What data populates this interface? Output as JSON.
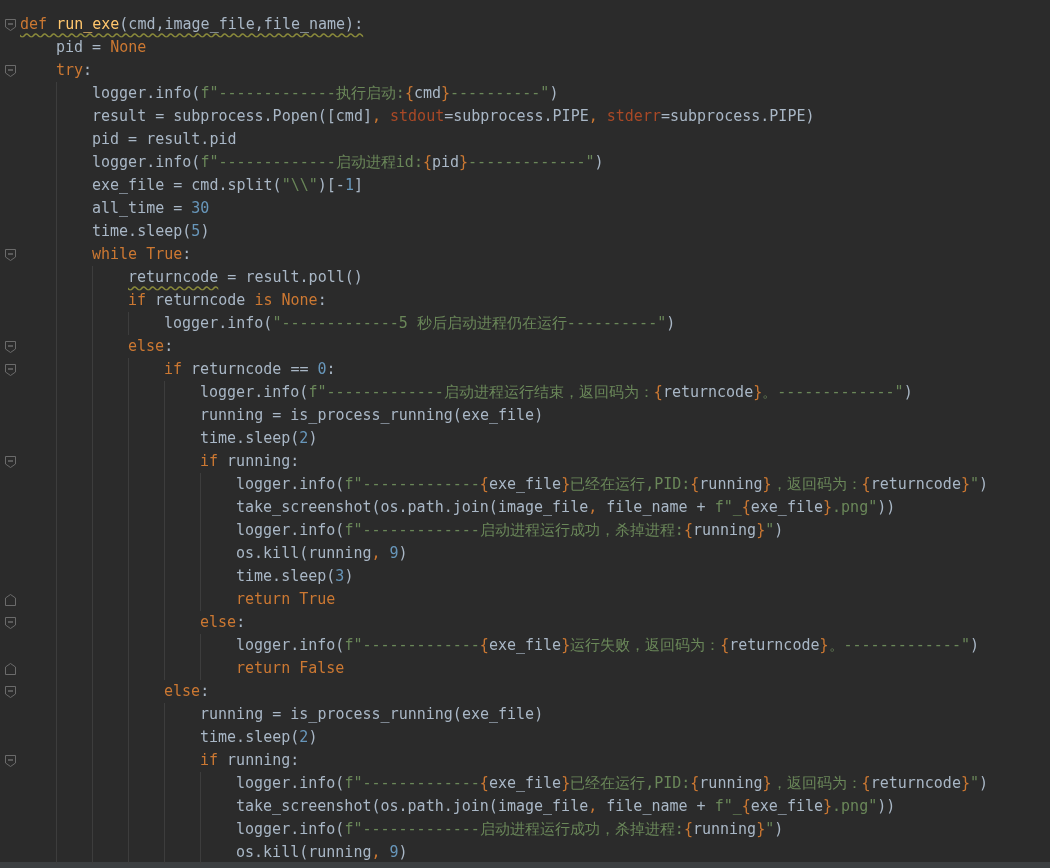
{
  "lines": [
    {
      "fold_start": true,
      "tokens": [
        {
          "kind": "kw",
          "text": "def ",
          "warning": true
        },
        {
          "kind": "fn",
          "text": "run_exe",
          "warning": true
        },
        {
          "kind": "plain",
          "text": "(cmd,image_file,file_name):",
          "warning": true
        }
      ],
      "children": [
        {
          "tokens": [
            {
              "kind": "plain",
              "text": "pid = "
            },
            {
              "kind": "kw",
              "text": "None"
            }
          ]
        },
        {
          "fold_start": true,
          "tokens": [
            {
              "kind": "kw",
              "text": "try"
            },
            {
              "kind": "plain",
              "text": ":"
            }
          ],
          "children": [
            {
              "tokens": [
                {
                  "kind": "plain",
                  "text": "logger.info("
                },
                {
                  "kind": "str",
                  "text": "f\"-------------执行启动:"
                },
                {
                  "kind": "brace",
                  "text": "{"
                },
                {
                  "kind": "plain",
                  "text": "cmd"
                },
                {
                  "kind": "brace",
                  "text": "}"
                },
                {
                  "kind": "str",
                  "text": "----------\""
                },
                {
                  "kind": "plain",
                  "text": ")"
                }
              ]
            },
            {
              "tokens": [
                {
                  "kind": "plain",
                  "text": "result = subprocess.Popen([cmd]"
                },
                {
                  "kind": "kw",
                  "text": ", "
                },
                {
                  "kind": "kwarg",
                  "text": "stdout"
                },
                {
                  "kind": "plain",
                  "text": "=subprocess.PIPE"
                },
                {
                  "kind": "kw",
                  "text": ", "
                },
                {
                  "kind": "kwarg",
                  "text": "stderr"
                },
                {
                  "kind": "plain",
                  "text": "=subprocess.PIPE)"
                }
              ]
            },
            {
              "tokens": [
                {
                  "kind": "plain",
                  "text": "pid = result.pid"
                }
              ]
            },
            {
              "tokens": [
                {
                  "kind": "plain",
                  "text": "logger.info("
                },
                {
                  "kind": "str",
                  "text": "f\"-------------启动进程id:"
                },
                {
                  "kind": "brace",
                  "text": "{"
                },
                {
                  "kind": "plain",
                  "text": "pid"
                },
                {
                  "kind": "brace",
                  "text": "}"
                },
                {
                  "kind": "str",
                  "text": "-------------\""
                },
                {
                  "kind": "plain",
                  "text": ")"
                }
              ]
            },
            {
              "tokens": [
                {
                  "kind": "plain",
                  "text": "exe_file = cmd.split("
                },
                {
                  "kind": "str",
                  "text": "\"\\\\\""
                },
                {
                  "kind": "plain",
                  "text": ")[-"
                },
                {
                  "kind": "num",
                  "text": "1"
                },
                {
                  "kind": "plain",
                  "text": "]"
                }
              ]
            },
            {
              "tokens": [
                {
                  "kind": "plain",
                  "text": "all_time = "
                },
                {
                  "kind": "num",
                  "text": "30"
                }
              ]
            },
            {
              "tokens": [
                {
                  "kind": "plain",
                  "text": "time.sleep("
                },
                {
                  "kind": "num",
                  "text": "5"
                },
                {
                  "kind": "plain",
                  "text": ")"
                }
              ]
            },
            {
              "fold_start": true,
              "tokens": [
                {
                  "kind": "kw",
                  "text": "while True"
                },
                {
                  "kind": "plain",
                  "text": ":"
                }
              ],
              "children": [
                {
                  "tokens": [
                    {
                      "kind": "plain",
                      "text": "returncode",
                      "warning": true
                    },
                    {
                      "kind": "plain",
                      "text": " = result.poll()"
                    }
                  ]
                },
                {
                  "tokens": [
                    {
                      "kind": "kw",
                      "text": "if "
                    },
                    {
                      "kind": "plain",
                      "text": "returncode "
                    },
                    {
                      "kind": "kw",
                      "text": "is None"
                    },
                    {
                      "kind": "plain",
                      "text": ":"
                    }
                  ],
                  "children": [
                    {
                      "tokens": [
                        {
                          "kind": "plain",
                          "text": "logger.info("
                        },
                        {
                          "kind": "str",
                          "text": "\"-------------5 秒后启动进程仍在运行----------\""
                        },
                        {
                          "kind": "plain",
                          "text": ")"
                        }
                      ]
                    }
                  ]
                },
                {
                  "fold_start": true,
                  "tokens": [
                    {
                      "kind": "kw",
                      "text": "else"
                    },
                    {
                      "kind": "plain",
                      "text": ":"
                    }
                  ],
                  "children": [
                    {
                      "fold_start": true,
                      "tokens": [
                        {
                          "kind": "kw",
                          "text": "if "
                        },
                        {
                          "kind": "plain",
                          "text": "returncode == "
                        },
                        {
                          "kind": "num",
                          "text": "0"
                        },
                        {
                          "kind": "plain",
                          "text": ":"
                        }
                      ],
                      "children": [
                        {
                          "tokens": [
                            {
                              "kind": "plain",
                              "text": "logger.info("
                            },
                            {
                              "kind": "str",
                              "text": "f\"-------------启动进程运行结束，返回码为："
                            },
                            {
                              "kind": "brace",
                              "text": "{"
                            },
                            {
                              "kind": "plain",
                              "text": "returncode"
                            },
                            {
                              "kind": "brace",
                              "text": "}"
                            },
                            {
                              "kind": "str",
                              "text": "。-------------\""
                            },
                            {
                              "kind": "plain",
                              "text": ")"
                            }
                          ]
                        },
                        {
                          "tokens": [
                            {
                              "kind": "plain",
                              "text": "running = is_process_running(exe_file)"
                            }
                          ]
                        },
                        {
                          "tokens": [
                            {
                              "kind": "plain",
                              "text": "time.sleep("
                            },
                            {
                              "kind": "num",
                              "text": "2"
                            },
                            {
                              "kind": "plain",
                              "text": ")"
                            }
                          ]
                        },
                        {
                          "fold_start": true,
                          "tokens": [
                            {
                              "kind": "kw",
                              "text": "if "
                            },
                            {
                              "kind": "plain",
                              "text": "running:"
                            }
                          ],
                          "children": [
                            {
                              "tokens": [
                                {
                                  "kind": "plain",
                                  "text": "logger.info("
                                },
                                {
                                  "kind": "str",
                                  "text": "f\"-------------"
                                },
                                {
                                  "kind": "brace",
                                  "text": "{"
                                },
                                {
                                  "kind": "plain",
                                  "text": "exe_file"
                                },
                                {
                                  "kind": "brace",
                                  "text": "}"
                                },
                                {
                                  "kind": "str",
                                  "text": "已经在运行,PID:"
                                },
                                {
                                  "kind": "brace",
                                  "text": "{"
                                },
                                {
                                  "kind": "plain",
                                  "text": "running"
                                },
                                {
                                  "kind": "brace",
                                  "text": "}"
                                },
                                {
                                  "kind": "str",
                                  "text": "，返回码为："
                                },
                                {
                                  "kind": "brace",
                                  "text": "{"
                                },
                                {
                                  "kind": "plain",
                                  "text": "returncode"
                                },
                                {
                                  "kind": "brace",
                                  "text": "}"
                                },
                                {
                                  "kind": "str",
                                  "text": "\""
                                },
                                {
                                  "kind": "plain",
                                  "text": ")"
                                }
                              ]
                            },
                            {
                              "tokens": [
                                {
                                  "kind": "plain",
                                  "text": "take_screenshot(os.path.join(image_file"
                                },
                                {
                                  "kind": "kw",
                                  "text": ", "
                                },
                                {
                                  "kind": "plain",
                                  "text": "file_name + "
                                },
                                {
                                  "kind": "str",
                                  "text": "f\"_"
                                },
                                {
                                  "kind": "brace",
                                  "text": "{"
                                },
                                {
                                  "kind": "plain",
                                  "text": "exe_file"
                                },
                                {
                                  "kind": "brace",
                                  "text": "}"
                                },
                                {
                                  "kind": "str",
                                  "text": ".png\""
                                },
                                {
                                  "kind": "plain",
                                  "text": "))"
                                }
                              ]
                            },
                            {
                              "tokens": [
                                {
                                  "kind": "plain",
                                  "text": "logger.info("
                                },
                                {
                                  "kind": "str",
                                  "text": "f\"-------------启动进程运行成功，杀掉进程:"
                                },
                                {
                                  "kind": "brace",
                                  "text": "{"
                                },
                                {
                                  "kind": "plain",
                                  "text": "running"
                                },
                                {
                                  "kind": "brace",
                                  "text": "}"
                                },
                                {
                                  "kind": "str",
                                  "text": "\""
                                },
                                {
                                  "kind": "plain",
                                  "text": ")"
                                }
                              ]
                            },
                            {
                              "tokens": [
                                {
                                  "kind": "plain",
                                  "text": "os.kill(running"
                                },
                                {
                                  "kind": "kw",
                                  "text": ", "
                                },
                                {
                                  "kind": "num",
                                  "text": "9"
                                },
                                {
                                  "kind": "plain",
                                  "text": ")"
                                }
                              ]
                            },
                            {
                              "tokens": [
                                {
                                  "kind": "plain",
                                  "text": "time.sleep("
                                },
                                {
                                  "kind": "num",
                                  "text": "3"
                                },
                                {
                                  "kind": "plain",
                                  "text": ")"
                                }
                              ]
                            },
                            {
                              "fold_end": true,
                              "tokens": [
                                {
                                  "kind": "kw",
                                  "text": "return True"
                                }
                              ]
                            }
                          ]
                        },
                        {
                          "fold_start": true,
                          "tokens": [
                            {
                              "kind": "kw",
                              "text": "else"
                            },
                            {
                              "kind": "plain",
                              "text": ":"
                            }
                          ],
                          "children": [
                            {
                              "tokens": [
                                {
                                  "kind": "plain",
                                  "text": "logger.info("
                                },
                                {
                                  "kind": "str",
                                  "text": "f\"-------------"
                                },
                                {
                                  "kind": "brace",
                                  "text": "{"
                                },
                                {
                                  "kind": "plain",
                                  "text": "exe_file"
                                },
                                {
                                  "kind": "brace",
                                  "text": "}"
                                },
                                {
                                  "kind": "str",
                                  "text": "运行失败，返回码为："
                                },
                                {
                                  "kind": "brace",
                                  "text": "{"
                                },
                                {
                                  "kind": "plain",
                                  "text": "returncode"
                                },
                                {
                                  "kind": "brace",
                                  "text": "}"
                                },
                                {
                                  "kind": "str",
                                  "text": "。-------------\""
                                },
                                {
                                  "kind": "plain",
                                  "text": ")"
                                }
                              ]
                            },
                            {
                              "fold_end": true,
                              "tokens": [
                                {
                                  "kind": "kw",
                                  "text": "return False"
                                }
                              ]
                            }
                          ]
                        }
                      ]
                    },
                    {
                      "fold_start": true,
                      "tokens": [
                        {
                          "kind": "kw",
                          "text": "else"
                        },
                        {
                          "kind": "plain",
                          "text": ":"
                        }
                      ],
                      "children": [
                        {
                          "tokens": [
                            {
                              "kind": "plain",
                              "text": "running = is_process_running(exe_file)"
                            }
                          ]
                        },
                        {
                          "tokens": [
                            {
                              "kind": "plain",
                              "text": "time.sleep("
                            },
                            {
                              "kind": "num",
                              "text": "2"
                            },
                            {
                              "kind": "plain",
                              "text": ")"
                            }
                          ]
                        },
                        {
                          "fold_start": true,
                          "tokens": [
                            {
                              "kind": "kw",
                              "text": "if "
                            },
                            {
                              "kind": "plain",
                              "text": "running:"
                            }
                          ],
                          "children": [
                            {
                              "tokens": [
                                {
                                  "kind": "plain",
                                  "text": "logger.info("
                                },
                                {
                                  "kind": "str",
                                  "text": "f\"-------------"
                                },
                                {
                                  "kind": "brace",
                                  "text": "{"
                                },
                                {
                                  "kind": "plain",
                                  "text": "exe_file"
                                },
                                {
                                  "kind": "brace",
                                  "text": "}"
                                },
                                {
                                  "kind": "str",
                                  "text": "已经在运行,PID:"
                                },
                                {
                                  "kind": "brace",
                                  "text": "{"
                                },
                                {
                                  "kind": "plain",
                                  "text": "running"
                                },
                                {
                                  "kind": "brace",
                                  "text": "}"
                                },
                                {
                                  "kind": "str",
                                  "text": "，返回码为："
                                },
                                {
                                  "kind": "brace",
                                  "text": "{"
                                },
                                {
                                  "kind": "plain",
                                  "text": "returncode"
                                },
                                {
                                  "kind": "brace",
                                  "text": "}"
                                },
                                {
                                  "kind": "str",
                                  "text": "\""
                                },
                                {
                                  "kind": "plain",
                                  "text": ")"
                                }
                              ]
                            },
                            {
                              "tokens": [
                                {
                                  "kind": "plain",
                                  "text": "take_screenshot(os.path.join(image_file"
                                },
                                {
                                  "kind": "kw",
                                  "text": ", "
                                },
                                {
                                  "kind": "plain",
                                  "text": "file_name + "
                                },
                                {
                                  "kind": "str",
                                  "text": "f\"_"
                                },
                                {
                                  "kind": "brace",
                                  "text": "{"
                                },
                                {
                                  "kind": "plain",
                                  "text": "exe_file"
                                },
                                {
                                  "kind": "brace",
                                  "text": "}"
                                },
                                {
                                  "kind": "str",
                                  "text": ".png\""
                                },
                                {
                                  "kind": "plain",
                                  "text": "))"
                                }
                              ]
                            },
                            {
                              "tokens": [
                                {
                                  "kind": "plain",
                                  "text": "logger.info("
                                },
                                {
                                  "kind": "str",
                                  "text": "f\"-------------启动进程运行成功，杀掉进程:"
                                },
                                {
                                  "kind": "brace",
                                  "text": "{"
                                },
                                {
                                  "kind": "plain",
                                  "text": "running"
                                },
                                {
                                  "kind": "brace",
                                  "text": "}"
                                },
                                {
                                  "kind": "str",
                                  "text": "\""
                                },
                                {
                                  "kind": "plain",
                                  "text": ")"
                                }
                              ]
                            },
                            {
                              "tokens": [
                                {
                                  "kind": "plain",
                                  "text": "os.kill(running"
                                },
                                {
                                  "kind": "kw",
                                  "text": ", "
                                },
                                {
                                  "kind": "num",
                                  "text": "9"
                                },
                                {
                                  "kind": "plain",
                                  "text": ")"
                                }
                              ]
                            }
                          ]
                        }
                      ]
                    }
                  ]
                }
              ]
            }
          ]
        }
      ]
    }
  ]
}
